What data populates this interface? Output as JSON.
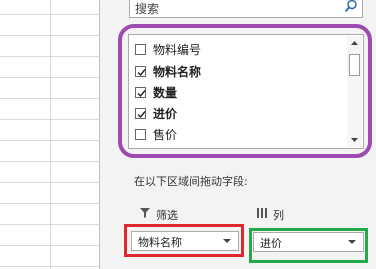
{
  "search": {
    "placeholder": "搜索",
    "icon": "search-icon"
  },
  "field_list": {
    "items": [
      {
        "label": "物料编号",
        "checked": false,
        "bold": false
      },
      {
        "label": "物料名称",
        "checked": true,
        "bold": true
      },
      {
        "label": "数量",
        "checked": true,
        "bold": true
      },
      {
        "label": "进价",
        "checked": true,
        "bold": true
      },
      {
        "label": "售价",
        "checked": false,
        "bold": false
      }
    ]
  },
  "areas": {
    "instruction": "在以下区域间拖动字段:",
    "filter": {
      "title": "筛选",
      "icon": "filter-icon",
      "field": "物料名称"
    },
    "columns": {
      "title": "列",
      "icon": "columns-icon",
      "field": "进价"
    }
  },
  "colors": {
    "highlight_purple": "#9d4bb0",
    "highlight_red": "#e0292d",
    "highlight_green": "#27a94a"
  }
}
